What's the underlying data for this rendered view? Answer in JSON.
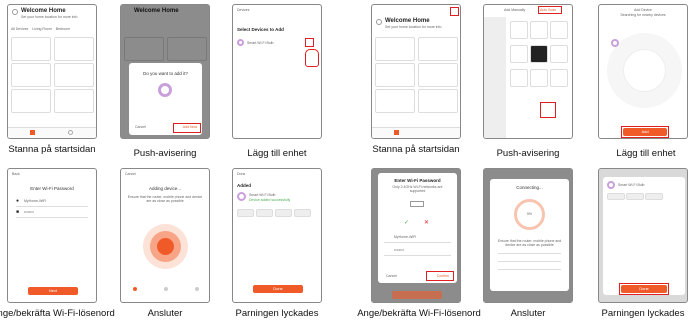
{
  "left": {
    "captions": [
      "Stanna på startsidan",
      "Push-avisering",
      "Lägg till enhet",
      "Ange/bekräfta Wi-Fi-lösenord",
      "Ansluter",
      "Parningen lyckades"
    ],
    "home": {
      "title": "Welcome Home",
      "subtitle": "Set your home location for more info",
      "tabs": [
        "All Devices",
        "Living Room",
        "Bedroom",
        "Kitchen",
        "..."
      ]
    },
    "push": {
      "title": "Welcome Home",
      "dialog_title": "Do you want to add it?",
      "cancel": "Cancel",
      "confirm": "Add Now"
    },
    "add": {
      "header": "Devices",
      "title": "Select Devices to Add",
      "device": "Smart Wi-Fi Bulb"
    },
    "wifi": {
      "back": "Back",
      "title": "Enter Wi-Fi Password",
      "ssid": "MyHome-WiFi",
      "password": "••••••••",
      "button": "Next"
    },
    "connecting": {
      "header": "Cancel",
      "title": "Adding device...",
      "hint": "Ensure that the router, mobile phone and device are as close as possible"
    },
    "success": {
      "header": "Done",
      "title": "Added",
      "device": "Smart Wi-Fi Bulb",
      "status": "Device added successfully",
      "button": "Done"
    }
  },
  "right": {
    "captions": [
      "Stanna på startsidan",
      "Push-avisering",
      "Lägg till enhet",
      "Ange/bekräfta Wi-Fi-lösenord",
      "Ansluter",
      "Parningen lyckades"
    ],
    "home": {
      "title": "Welcome Home",
      "subtitle": "Set your home location for more info"
    },
    "push": {
      "tab_left": "Add Manually",
      "tab_right": "Auto Scan"
    },
    "add": {
      "header": "Add Device",
      "subtitle": "Searching for nearby devices",
      "button": "Add"
    },
    "wifi": {
      "title": "Enter Wi-Fi Password",
      "sub": "Only 2.4GHz Wi-Fi networks are supported",
      "ssid": "MyHome-WiFi",
      "password": "••••••••",
      "cancel": "Cancel",
      "confirm": "Confirm"
    },
    "connecting": {
      "title": "Connecting...",
      "percent": "5%",
      "hint": "Ensure that the router, mobile phone and device are as close as possible"
    },
    "success": {
      "device": "Smart Wi-Fi Bulb",
      "button": "Done"
    }
  }
}
